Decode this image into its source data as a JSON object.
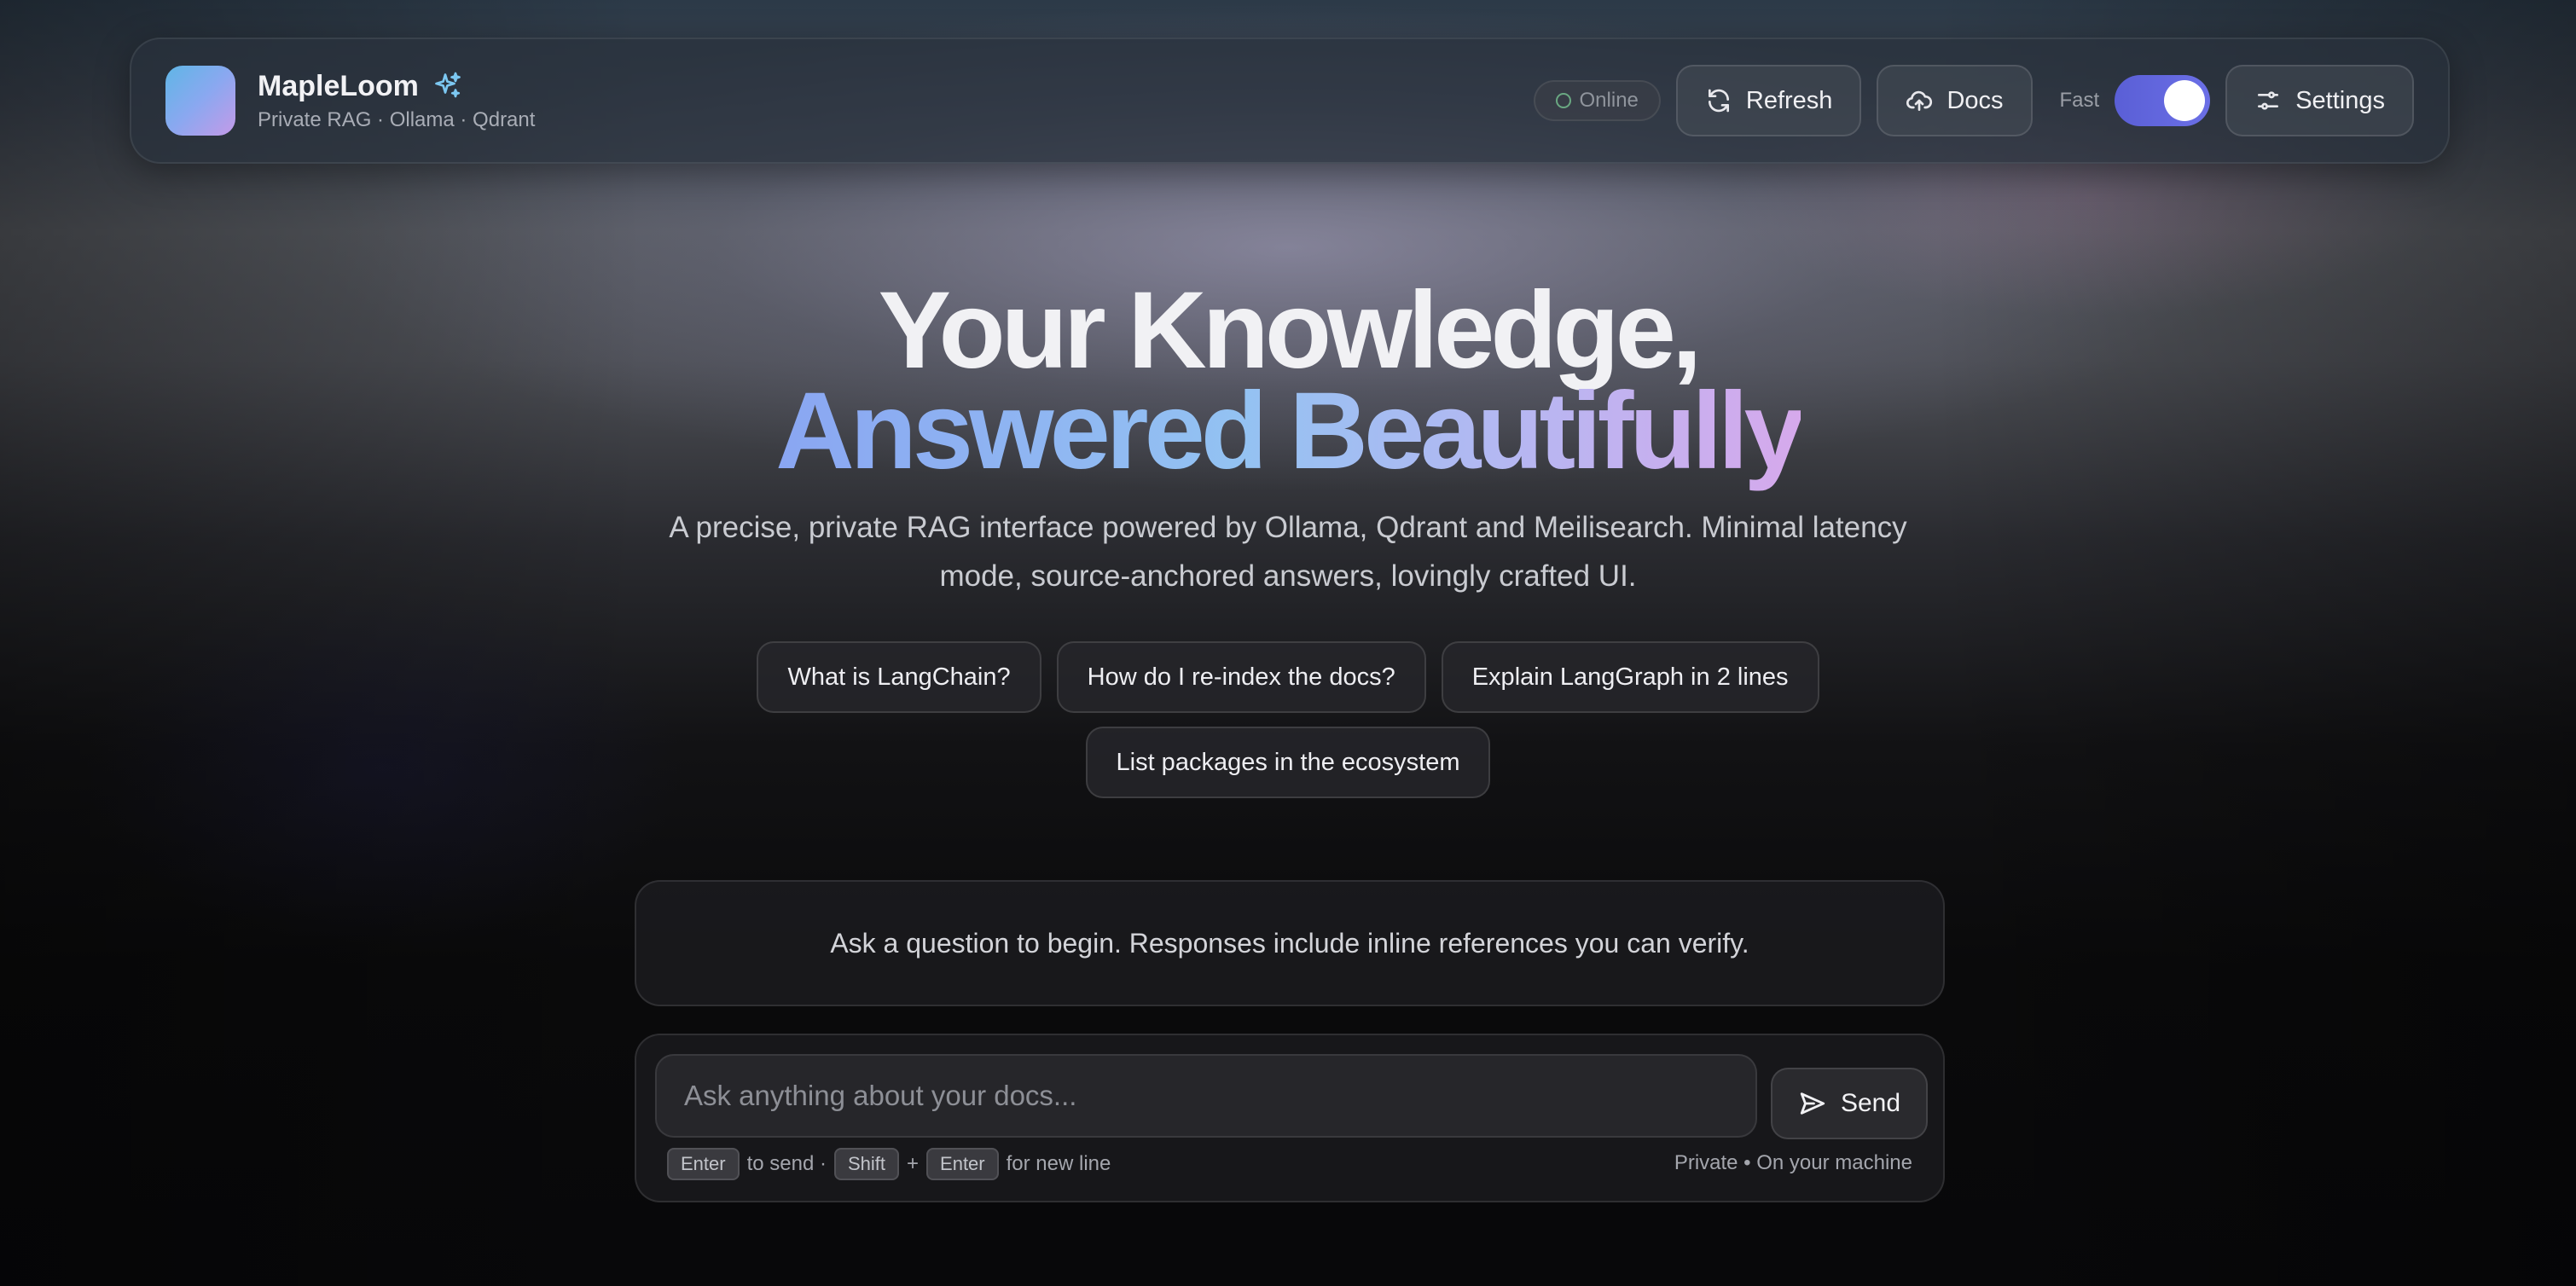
{
  "header": {
    "brand_name": "MapleLoom",
    "brand_sub": "Private RAG · Ollama · Qdrant",
    "status": "Online",
    "refresh_label": "Refresh",
    "docs_label": "Docs",
    "fast_label": "Fast",
    "fast_enabled": true,
    "settings_label": "Settings"
  },
  "hero": {
    "title_line1": "Your Knowledge,",
    "title_line2": "Answered Beautifully",
    "subtitle": "A precise, private RAG interface powered by Ollama, Qdrant and Meilisearch. Minimal latency mode, source-anchored answers, lovingly crafted UI."
  },
  "suggestions": [
    "What is LangChain?",
    "How do I re-index the docs?",
    "Explain LangGraph in 2 lines",
    "List packages in the ecosystem"
  ],
  "empty_state": "Ask a question to begin. Responses include inline references you can verify.",
  "composer": {
    "placeholder": "Ask anything about your docs...",
    "value": "",
    "send_label": "Send",
    "hint_key_enter": "Enter",
    "hint_to_send": "to send ·",
    "hint_key_shift": "Shift",
    "hint_plus": "+",
    "hint_key_enter2": "Enter",
    "hint_new_line": "for new line",
    "privacy": "Private • On your machine"
  },
  "colors": {
    "accent_toggle": "#5a5fd6",
    "gradient_start": "#8aa6f2",
    "gradient_end": "#d6a9ec",
    "status_dot": "#6aa882"
  },
  "icons": {
    "logo": "app-logo-gradient",
    "brand": "sparkles-icon",
    "refresh": "refresh-icon",
    "docs": "cloud-upload-icon",
    "settings": "sliders-icon",
    "send": "send-icon"
  }
}
